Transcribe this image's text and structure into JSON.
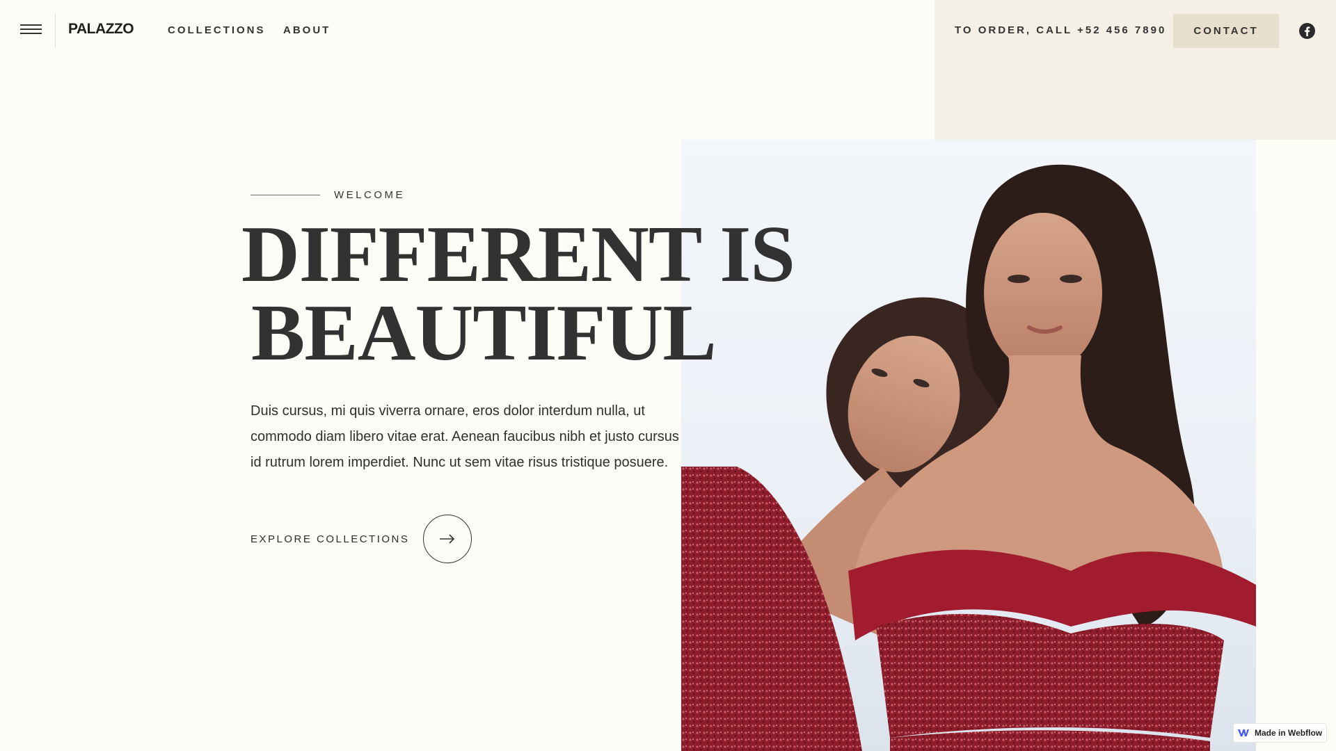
{
  "header": {
    "logo": "PALAZZO",
    "nav": [
      {
        "label": "COLLECTIONS"
      },
      {
        "label": "ABOUT"
      }
    ],
    "phone": "TO ORDER, CALL +52 456 7890",
    "contact_label": "CONTACT"
  },
  "hero": {
    "eyebrow": "WELCOME",
    "title_line1": "DIFFERENT IS",
    "title_line2": "BEAUTIFUL",
    "body": "Duis cursus, mi quis viverra ornare, eros dolor interdum nulla, ut commodo diam libero vitae erat. Aenean faucibus nibh et justo cursus id rutrum lorem imperdiet. Nunc ut sem vitae risus tristique posuere.",
    "cta_label": "EXPLORE COLLECTIONS"
  },
  "badge": {
    "label": "Made in Webflow"
  },
  "colors": {
    "page_bg": "#fefcf6",
    "panel_bg": "#f4f0e6",
    "contact_bg": "#e7dfcd",
    "text": "#323232",
    "dress_red": "#9e1b2c"
  },
  "icons": [
    "hamburger-menu-icon",
    "facebook-icon",
    "arrow-right-icon",
    "webflow-logo-icon"
  ]
}
